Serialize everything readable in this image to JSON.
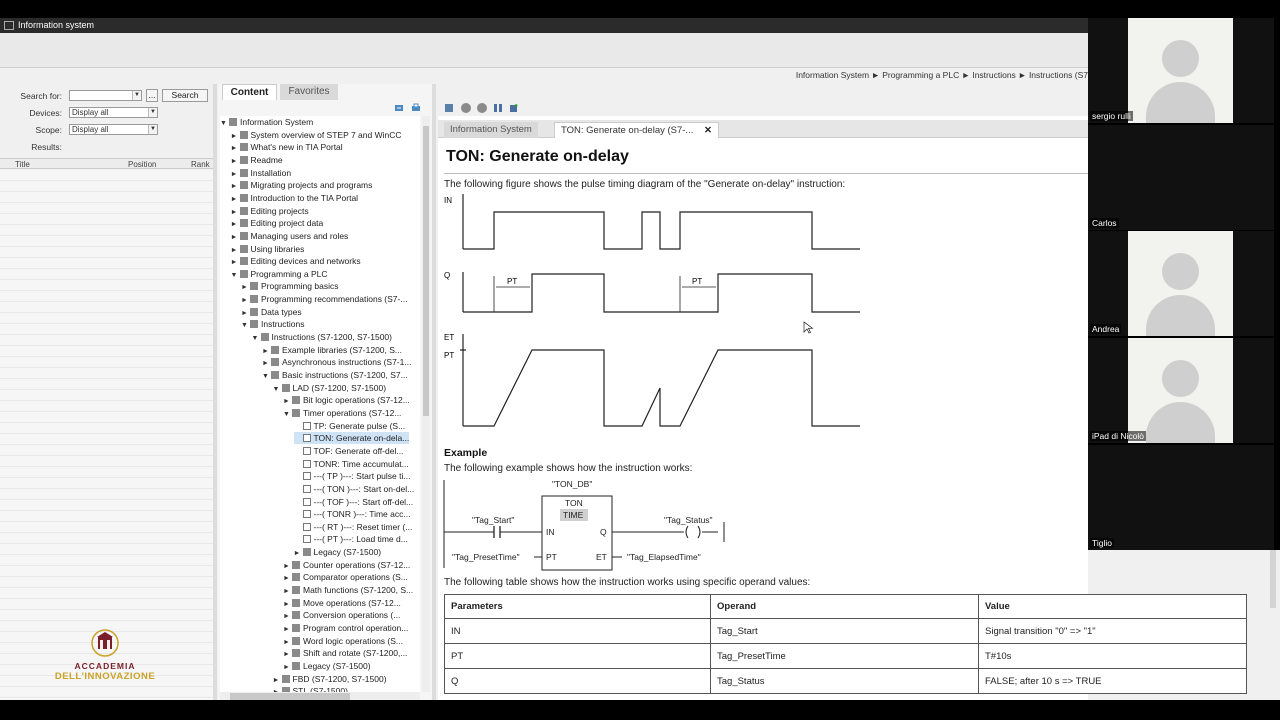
{
  "window": {
    "title": "Information system"
  },
  "breadcrumb": "Information System ► Programming a PLC ► Instructions ► Instructions (S7",
  "search": {
    "search_label": "Search for:",
    "search_value": "",
    "search_button": "Search",
    "more_button": "...",
    "devices_label": "Devices:",
    "devices_value": "Display all",
    "scope_label": "Scope:",
    "scope_value": "Display all",
    "results_label": "Results:",
    "columns": [
      "Title",
      "Position",
      "Rank"
    ]
  },
  "logo": {
    "line1": "ACCADEMIA",
    "line2": "DELL'INNOVAZIONE"
  },
  "nav_tabs": [
    "Content",
    "Favorites"
  ],
  "tree": [
    {
      "label": "Information System",
      "arrow": "▼"
    },
    {
      "label": "System overview of STEP 7 and WinCC",
      "arrow": "►"
    },
    {
      "label": "What's new in TIA Portal",
      "arrow": "►"
    },
    {
      "label": "Readme",
      "arrow": "►"
    },
    {
      "label": "Installation",
      "arrow": "►"
    },
    {
      "label": "Migrating projects and programs",
      "arrow": "►"
    },
    {
      "label": "Introduction to the TIA Portal",
      "arrow": "►"
    },
    {
      "label": "Editing projects",
      "arrow": "►"
    },
    {
      "label": "Editing project data",
      "arrow": "►"
    },
    {
      "label": "Managing users and roles",
      "arrow": "►"
    },
    {
      "label": "Using libraries",
      "arrow": "►"
    },
    {
      "label": "Editing devices and networks",
      "arrow": "►"
    },
    {
      "label": "Programming a PLC",
      "arrow": "▼"
    },
    {
      "label": "Programming basics",
      "arrow": "►"
    },
    {
      "label": "Programming recommendations (S7-...",
      "arrow": "►"
    },
    {
      "label": "Data types",
      "arrow": "►"
    },
    {
      "label": "Instructions",
      "arrow": "▼"
    },
    {
      "label": "Instructions (S7-1200, S7-1500)",
      "arrow": "▼"
    },
    {
      "label": "Example libraries (S7-1200, S...",
      "arrow": "►"
    },
    {
      "label": "Asynchronous instructions (S7-1...",
      "arrow": "►"
    },
    {
      "label": "Basic instructions (S7-1200, S7...",
      "arrow": "▼"
    },
    {
      "label": "LAD (S7-1200, S7-1500)",
      "arrow": "▼"
    },
    {
      "label": "Bit logic operations (S7-12...",
      "arrow": "►"
    },
    {
      "label": "Timer operations (S7-12...",
      "arrow": "▼"
    },
    {
      "label": "TP: Generate pulse (S...",
      "arrow": ""
    },
    {
      "label": "TON: Generate on-dela...",
      "arrow": ""
    },
    {
      "label": "TOF: Generate off-del...",
      "arrow": ""
    },
    {
      "label": "TONR: Time accumulat...",
      "arrow": ""
    },
    {
      "label": "---( TP )---: Start pulse ti...",
      "arrow": ""
    },
    {
      "label": "---( TON )---: Start on-del...",
      "arrow": ""
    },
    {
      "label": "---( TOF )---: Start off-del...",
      "arrow": ""
    },
    {
      "label": "---( TONR )---: Time acc...",
      "arrow": ""
    },
    {
      "label": "---( RT )---: Reset timer (...",
      "arrow": ""
    },
    {
      "label": "---( PT )---: Load time d...",
      "arrow": ""
    },
    {
      "label": "Legacy (S7-1500)",
      "arrow": "►"
    },
    {
      "label": "Counter operations (S7-12...",
      "arrow": "►"
    },
    {
      "label": "Comparator operations (S...",
      "arrow": "►"
    },
    {
      "label": "Math functions (S7-1200, S...",
      "arrow": "►"
    },
    {
      "label": "Move operations (S7-12...",
      "arrow": "►"
    },
    {
      "label": "Conversion operations (...",
      "arrow": "►"
    },
    {
      "label": "Program control operation...",
      "arrow": "►"
    },
    {
      "label": "Word logic operations (S...",
      "arrow": "►"
    },
    {
      "label": "Shift and rotate (S7-1200,...",
      "arrow": "►"
    },
    {
      "label": "Legacy (S7-1500)",
      "arrow": "►"
    },
    {
      "label": "FBD (S7-1200, S7-1500)",
      "arrow": "►"
    },
    {
      "label": "STL (S7-1500)",
      "arrow": "►"
    }
  ],
  "doc_tabs": {
    "first": "Information System",
    "second": "TON: Generate on-delay (S7-...",
    "close": "✕"
  },
  "doc": {
    "title": "TON: Generate on-delay",
    "intro": "The following figure shows the pulse timing diagram of the \"Generate on-delay\" instruction:",
    "diagram_labels": {
      "in": "IN",
      "q": "Q",
      "et": "ET",
      "pt": "PT",
      "pt_marker": "PT"
    },
    "example_heading": "Example",
    "example_text": "The following example shows how the instruction works:",
    "ladder": {
      "db": "\"TON_DB\"",
      "block": "TON",
      "type": "TIME",
      "in_pin": "IN",
      "q_pin": "Q",
      "pt_pin": "PT",
      "et_pin": "ET",
      "start_tag": "\"Tag_Start\"",
      "status_tag": "\"Tag_Status\"",
      "preset_tag": "\"Tag_PresetTime\"",
      "elapsed_tag": "\"Tag_ElapsedTime\""
    },
    "table_intro": "The following table shows how the instruction works using specific operand values:",
    "table": {
      "headers": [
        "Parameters",
        "Operand",
        "Value"
      ],
      "rows": [
        [
          "IN",
          "Tag_Start",
          "Signal transition \"0\" => \"1\""
        ],
        [
          "PT",
          "Tag_PresetTime",
          "T#10s"
        ],
        [
          "Q",
          "Tag_Status",
          "FALSE; after 10 s => TRUE"
        ]
      ]
    }
  },
  "participants": [
    "sergio rulli",
    "Carlos",
    "Andrea",
    "iPad di Nicolò",
    "Tiglio"
  ]
}
